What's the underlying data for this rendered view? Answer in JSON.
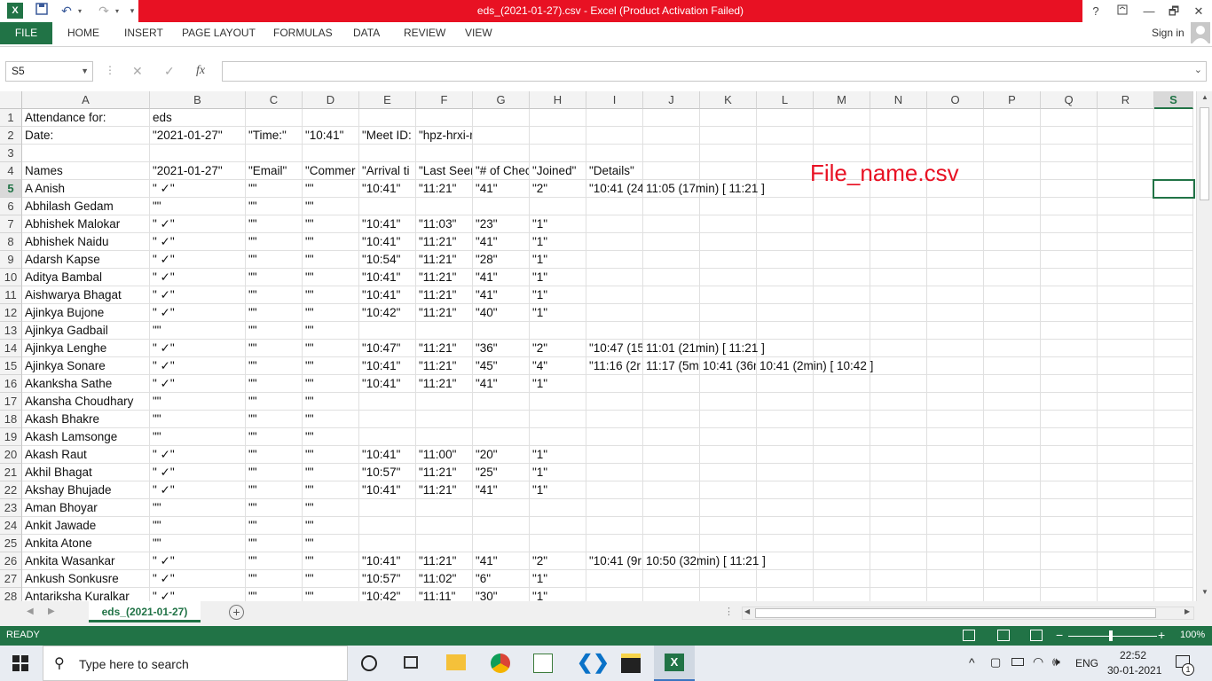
{
  "window": {
    "title": "eds_(2021-01-27).csv -  Excel (Product Activation Failed)",
    "help": "?",
    "min": "—",
    "restore": "🗗",
    "close": "✕"
  },
  "ribbon": {
    "file": "FILE",
    "tabs": [
      "HOME",
      "INSERT",
      "PAGE LAYOUT",
      "FORMULAS",
      "DATA",
      "REVIEW",
      "VIEW"
    ],
    "signin": "Sign in"
  },
  "formula_bar": {
    "name_box": "S5",
    "fx": "fx",
    "value": ""
  },
  "columns": [
    "A",
    "B",
    "C",
    "D",
    "E",
    "F",
    "G",
    "H",
    "I",
    "J",
    "K",
    "L",
    "M",
    "N",
    "O",
    "P",
    "Q",
    "R",
    "S"
  ],
  "rows": [
    {
      "n": "1",
      "a": "Attendance for:",
      "b": "eds",
      "c": "",
      "d": "",
      "e": "",
      "f": "",
      "g": "",
      "h": "",
      "i": ""
    },
    {
      "n": "2",
      "a": "Date:",
      "b": "\"2021-01-27\"",
      "c": "\"Time:\"",
      "d": "\"10:41\"",
      "e": "\"Meet ID:",
      "f": "\"hpz-hrxi-mej\"",
      "g": "",
      "h": "",
      "i": ""
    },
    {
      "n": "3",
      "a": "",
      "b": "",
      "c": "",
      "d": "",
      "e": "",
      "f": "",
      "g": "",
      "h": "",
      "i": ""
    },
    {
      "n": "4",
      "a": "Names",
      "b": "\"2021-01-27\"",
      "c": "\"Email\"",
      "d": "\"Commer",
      "e": "\"Arrival ti",
      "f": "\"Last Seer",
      "g": "\"# of Chec",
      "h": "\"Joined\"",
      "i": "\"Details\""
    },
    {
      "n": "5",
      "a": "A Anish",
      "b": "\" ✓\"",
      "c": "\"\"",
      "d": "\"\"",
      "e": "\"10:41\"",
      "f": "\"11:21\"",
      "g": "\"41\"",
      "h": "\"2\"",
      "i": "\"10:41 (24",
      "j": "11:05 (17min) [ 11:21 ]"
    },
    {
      "n": "6",
      "a": "Abhilash Gedam",
      "b": "\"\"",
      "c": "\"\"",
      "d": "\"\"",
      "e": "",
      "f": "",
      "g": "",
      "h": "",
      "i": ""
    },
    {
      "n": "7",
      "a": "Abhishek Malokar",
      "b": "\" ✓\"",
      "c": "\"\"",
      "d": "\"\"",
      "e": "\"10:41\"",
      "f": "\"11:03\"",
      "g": "\"23\"",
      "h": "\"1\"",
      "i": ""
    },
    {
      "n": "8",
      "a": "Abhishek Naidu",
      "b": "\" ✓\"",
      "c": "\"\"",
      "d": "\"\"",
      "e": "\"10:41\"",
      "f": "\"11:21\"",
      "g": "\"41\"",
      "h": "\"1\"",
      "i": ""
    },
    {
      "n": "9",
      "a": "Adarsh Kapse",
      "b": "\" ✓\"",
      "c": "\"\"",
      "d": "\"\"",
      "e": "\"10:54\"",
      "f": "\"11:21\"",
      "g": "\"28\"",
      "h": "\"1\"",
      "i": ""
    },
    {
      "n": "10",
      "a": "Aditya Bambal",
      "b": "\" ✓\"",
      "c": "\"\"",
      "d": "\"\"",
      "e": "\"10:41\"",
      "f": "\"11:21\"",
      "g": "\"41\"",
      "h": "\"1\"",
      "i": ""
    },
    {
      "n": "11",
      "a": "Aishwarya Bhagat",
      "b": "\" ✓\"",
      "c": "\"\"",
      "d": "\"\"",
      "e": "\"10:41\"",
      "f": "\"11:21\"",
      "g": "\"41\"",
      "h": "\"1\"",
      "i": ""
    },
    {
      "n": "12",
      "a": "Ajinkya Bujone",
      "b": "\" ✓\"",
      "c": "\"\"",
      "d": "\"\"",
      "e": "\"10:42\"",
      "f": "\"11:21\"",
      "g": "\"40\"",
      "h": "\"1\"",
      "i": ""
    },
    {
      "n": "13",
      "a": "Ajinkya Gadbail",
      "b": "\"\"",
      "c": "\"\"",
      "d": "\"\"",
      "e": "",
      "f": "",
      "g": "",
      "h": "",
      "i": ""
    },
    {
      "n": "14",
      "a": "Ajinkya Lenghe",
      "b": "\" ✓\"",
      "c": "\"\"",
      "d": "\"\"",
      "e": "\"10:47\"",
      "f": "\"11:21\"",
      "g": "\"36\"",
      "h": "\"2\"",
      "i": "\"10:47 (15",
      "j": "11:01 (21min) [ 11:21 ]"
    },
    {
      "n": "15",
      "a": "Ajinkya Sonare",
      "b": "\" ✓\"",
      "c": "\"\"",
      "d": "\"\"",
      "e": "\"10:41\"",
      "f": "\"11:21\"",
      "g": "\"45\"",
      "h": "\"4\"",
      "i": "\"11:16 (2r",
      "j": "11:17 (5mi",
      "k": "10:41 (36n",
      "l": "10:41 (2min) [ 10:42 ]"
    },
    {
      "n": "16",
      "a": "Akanksha Sathe",
      "b": "\" ✓\"",
      "c": "\"\"",
      "d": "\"\"",
      "e": "\"10:41\"",
      "f": "\"11:21\"",
      "g": "\"41\"",
      "h": "\"1\"",
      "i": ""
    },
    {
      "n": "17",
      "a": "Akansha Choudhary",
      "b": "\"\"",
      "c": "\"\"",
      "d": "\"\"",
      "e": "",
      "f": "",
      "g": "",
      "h": "",
      "i": ""
    },
    {
      "n": "18",
      "a": "Akash Bhakre",
      "b": "\"\"",
      "c": "\"\"",
      "d": "\"\"",
      "e": "",
      "f": "",
      "g": "",
      "h": "",
      "i": ""
    },
    {
      "n": "19",
      "a": "Akash Lamsonge",
      "b": "\"\"",
      "c": "\"\"",
      "d": "\"\"",
      "e": "",
      "f": "",
      "g": "",
      "h": "",
      "i": ""
    },
    {
      "n": "20",
      "a": "Akash Raut",
      "b": "\" ✓\"",
      "c": "\"\"",
      "d": "\"\"",
      "e": "\"10:41\"",
      "f": "\"11:00\"",
      "g": "\"20\"",
      "h": "\"1\"",
      "i": ""
    },
    {
      "n": "21",
      "a": "Akhil Bhagat",
      "b": "\" ✓\"",
      "c": "\"\"",
      "d": "\"\"",
      "e": "\"10:57\"",
      "f": "\"11:21\"",
      "g": "\"25\"",
      "h": "\"1\"",
      "i": ""
    },
    {
      "n": "22",
      "a": "Akshay Bhujade",
      "b": "\" ✓\"",
      "c": "\"\"",
      "d": "\"\"",
      "e": "\"10:41\"",
      "f": "\"11:21\"",
      "g": "\"41\"",
      "h": "\"1\"",
      "i": ""
    },
    {
      "n": "23",
      "a": "Aman Bhoyar",
      "b": "\"\"",
      "c": "\"\"",
      "d": "\"\"",
      "e": "",
      "f": "",
      "g": "",
      "h": "",
      "i": ""
    },
    {
      "n": "24",
      "a": "Ankit Jawade",
      "b": "\"\"",
      "c": "\"\"",
      "d": "\"\"",
      "e": "",
      "f": "",
      "g": "",
      "h": "",
      "i": ""
    },
    {
      "n": "25",
      "a": "Ankita Atone",
      "b": "\"\"",
      "c": "\"\"",
      "d": "\"\"",
      "e": "",
      "f": "",
      "g": "",
      "h": "",
      "i": ""
    },
    {
      "n": "26",
      "a": "Ankita Wasankar",
      "b": "\" ✓\"",
      "c": "\"\"",
      "d": "\"\"",
      "e": "\"10:41\"",
      "f": "\"11:21\"",
      "g": "\"41\"",
      "h": "\"2\"",
      "i": "\"10:41 (9r",
      "j": "10:50 (32min) [ 11:21 ]"
    },
    {
      "n": "27",
      "a": "Ankush Sonkusre",
      "b": "\" ✓\"",
      "c": "\"\"",
      "d": "\"\"",
      "e": "\"10:57\"",
      "f": "\"11:02\"",
      "g": "\"6\"",
      "h": "\"1\"",
      "i": ""
    },
    {
      "n": "28",
      "a": "Antariksha Kuralkar",
      "b": "\" ✓\"",
      "c": "\"\"",
      "d": "\"\"",
      "e": "\"10:42\"",
      "f": "\"11:11\"",
      "g": "\"30\"",
      "h": "\"1\"",
      "i": ""
    }
  ],
  "overlay_text": "File_name.csv",
  "sheet_tab": "eds_(2021-01-27)",
  "status": {
    "ready": "READY",
    "zoom": "100%"
  },
  "taskbar": {
    "search_placeholder": "Type here to search",
    "lang": "ENG",
    "time": "22:52",
    "date": "30-01-2021",
    "notif_count": "1"
  },
  "colors": {
    "excel_green": "#217346",
    "title_red": "#e81123",
    "overlay_red": "#e81123"
  }
}
